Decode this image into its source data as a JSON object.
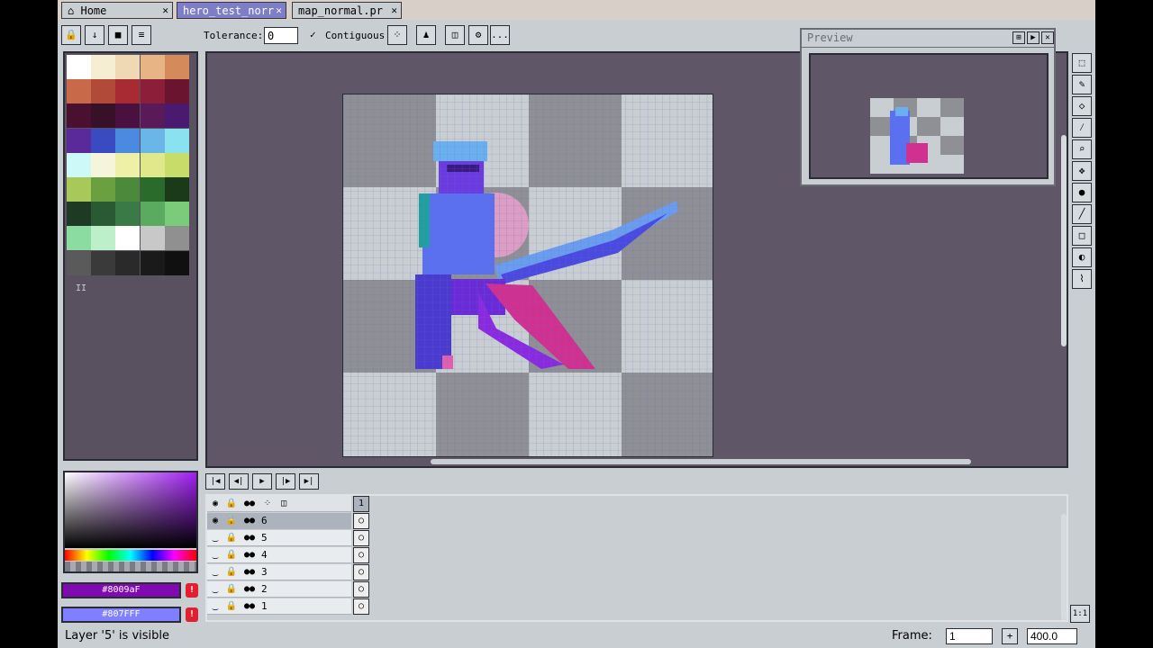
{
  "tabs": [
    {
      "label": "Home",
      "icon": "home-icon",
      "close": "✕"
    },
    {
      "label": "hero_test_norr",
      "close": "✕"
    },
    {
      "label": "map_normal.pr",
      "close": "✕"
    }
  ],
  "toolbar": {
    "tolerance_label": "Tolerance:",
    "tolerance_value": "0",
    "contiguous_label": "Contiguous",
    "contiguous_check": "✓",
    "more": "..."
  },
  "palette": {
    "colors": [
      "#ffffff",
      "#f5eed2",
      "#efd9b4",
      "#e7b486",
      "#d58a5c",
      "#c86a4a",
      "#b24a3a",
      "#a82a32",
      "#8c1e3a",
      "#6a1430",
      "#4a1030",
      "#381028",
      "#4a1040",
      "#5a1a5a",
      "#4a1a70",
      "#5a2a9a",
      "#3a4ac0",
      "#4a8ae0",
      "#6ab6e8",
      "#8ae2f0",
      "#cdfaf8",
      "#f5f5dc",
      "#eef0a8",
      "#dfe88a",
      "#c8dc6a",
      "#a8c85a",
      "#6aa040",
      "#4a8a3a",
      "#2a6a2a",
      "#1a3a1a",
      "#1e3a24",
      "#2a5a34",
      "#3a7a46",
      "#5aaa60",
      "#7acc7a",
      "#8adca0",
      "#bdf0c8",
      "#ffffff",
      "#c8c8c8",
      "#909090",
      "#5a5a5a",
      "#3a3a3a",
      "#2a2a2a",
      "#1a1a1a",
      "#101010"
    ],
    "marker": "II"
  },
  "preview": {
    "title": "Preview"
  },
  "colors": {
    "foreground": "#8009aF",
    "background": "#807FFF",
    "warning": "!"
  },
  "layers": [
    {
      "name": "6",
      "selected": true
    },
    {
      "name": "5",
      "selected": false
    },
    {
      "name": "4",
      "selected": false
    },
    {
      "name": "3",
      "selected": false
    },
    {
      "name": "2",
      "selected": false
    },
    {
      "name": "1",
      "selected": false
    }
  ],
  "frame_header": "1",
  "status": {
    "text": "Layer '5' is visible",
    "frame_label": "Frame:",
    "frame_value": "1",
    "zoom_value": "400.0",
    "one_to_one": "1:1"
  }
}
